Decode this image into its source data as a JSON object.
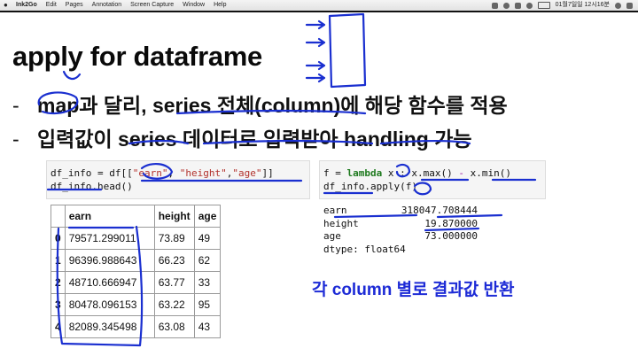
{
  "menubar": {
    "apple": "",
    "items": [
      "Ink2Go",
      "Edit",
      "Pages",
      "Annotation",
      "Screen Capture",
      "Window",
      "Help"
    ],
    "clock": "01월7일일 12시16분"
  },
  "slide": {
    "title": "apply for dataframe",
    "bullets": [
      {
        "dash": "-",
        "text": "map과 달리, series 전체(column)에 해당 함수를 적용"
      },
      {
        "dash": "-",
        "text": "입력값이 series 데이터로 입력받아 handling 가능"
      }
    ],
    "code_left": {
      "line1": {
        "p1": "df_info = df[[",
        "s1": "\"earn\"",
        "c1": ", ",
        "s2": "\"height\"",
        "c2": ",",
        "s3": "\"age\"",
        "p2": "]]"
      },
      "line2": "df_info.head()"
    },
    "code_right": {
      "line1": {
        "p1": "f = ",
        "kw": "lambda",
        "p2": " x : x.max() ",
        "op": "-",
        "p3": " x.min()"
      },
      "line2": "df_info.apply(f)"
    },
    "table": {
      "columns": [
        "",
        "earn",
        "height",
        "age"
      ],
      "rows": [
        {
          "idx": "0",
          "earn": "79571.299011",
          "height": "73.89",
          "age": "49"
        },
        {
          "idx": "1",
          "earn": "96396.988643",
          "height": "66.23",
          "age": "62"
        },
        {
          "idx": "2",
          "earn": "48710.666947",
          "height": "63.77",
          "age": "33"
        },
        {
          "idx": "3",
          "earn": "80478.096153",
          "height": "63.22",
          "age": "95"
        },
        {
          "idx": "4",
          "earn": "82089.345498",
          "height": "63.08",
          "age": "43"
        }
      ]
    },
    "output": [
      {
        "k": "earn",
        "v": "318047.708444"
      },
      {
        "k": "height",
        "v": "19.870000"
      },
      {
        "k": "age",
        "v": "73.000000"
      },
      {
        "k": "dtype: float64",
        "v": ""
      }
    ],
    "note": "각 column 별로 결과값 반환"
  },
  "colors": {
    "ink": "#1a2fd0",
    "note": "#1d2bd6",
    "code_bg": "#f5f5f5"
  }
}
